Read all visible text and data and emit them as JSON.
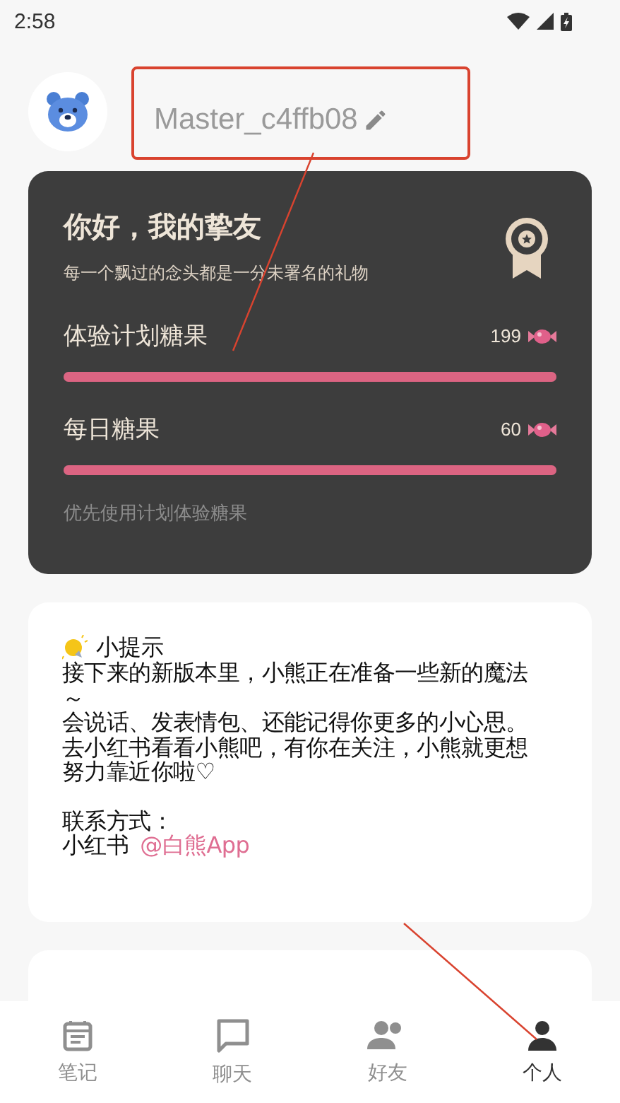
{
  "status_bar": {
    "time": "2:58"
  },
  "profile": {
    "username": "Master_c4ffb08"
  },
  "candy_card": {
    "title": "你好，我的挚友",
    "subtitle": "每一个飘过的念头都是一分未署名的礼物",
    "meters": [
      {
        "label": "体验计划糖果",
        "reading": "199",
        "level": 1
      },
      {
        "label": "每日糖果",
        "reading": "60",
        "level": 1
      }
    ],
    "note": "优先使用计划体验糖果"
  },
  "tip_card": {
    "title": "小提示",
    "lines": [
      "接下来的新版本里，小熊正在准备一些新的魔法～",
      "会说话、发表情包、还能记得你更多的小心思。",
      "去小红书看看小熊吧，有你在关注，小熊就更想努力靠近你啦♡"
    ],
    "contact_label": "联系方式：",
    "contact_platform": "小红书",
    "contact_link": "@白熊App"
  },
  "bottom_nav": [
    {
      "label": "笔记",
      "selected": false
    },
    {
      "label": "聊天",
      "selected": false
    },
    {
      "label": "好友",
      "selected": false
    },
    {
      "label": "个人",
      "selected": true
    }
  ]
}
